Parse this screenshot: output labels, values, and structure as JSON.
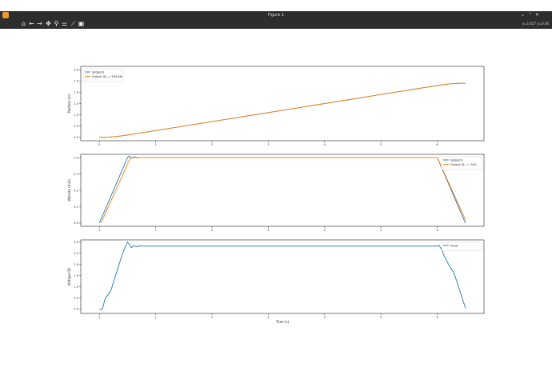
{
  "window": {
    "title": "Figure 1",
    "controls": [
      "⌄",
      "⌃",
      "✕"
    ]
  },
  "toolbar": {
    "tools": [
      {
        "name": "home-icon",
        "glyph": "⌂"
      },
      {
        "name": "back-icon",
        "glyph": "←"
      },
      {
        "name": "forward-icon",
        "glyph": "→"
      },
      {
        "name": "pan-icon",
        "glyph": "✥"
      },
      {
        "name": "zoom-icon",
        "glyph": "⚲"
      },
      {
        "name": "subplots-icon",
        "glyph": "⚌"
      },
      {
        "name": "edit-axes-icon",
        "glyph": "⟋"
      },
      {
        "name": "save-icon",
        "glyph": "▣"
      }
    ],
    "coords": "x=1.627 y=0.46"
  },
  "colors": {
    "setpoint": "#1f77b4",
    "output": "#ff7f0e"
  },
  "chart_data": [
    {
      "type": "line",
      "ylabel": "Position (m)",
      "xlabel": "",
      "xlim": [
        -0.33,
        6.83
      ],
      "ylim": [
        -0.15,
        3.15
      ],
      "xticks": [
        0,
        1,
        2,
        3,
        4,
        5,
        6
      ],
      "yticks": [
        0.0,
        0.5,
        1.0,
        1.5,
        2.0,
        2.5,
        3.0
      ],
      "legend": "top-left",
      "series": [
        {
          "name": "Setpoint",
          "color": "#1f77b4",
          "x": [
            0,
            0.1,
            0.2,
            0.3,
            0.4,
            0.5,
            0.57,
            1,
            2,
            3,
            4,
            5,
            6,
            6.1,
            6.2,
            6.3,
            6.4,
            6.5
          ],
          "y": [
            0,
            0.0041,
            0.0165,
            0.0371,
            0.066,
            0.1031,
            0.1344,
            0.3,
            0.7,
            1.1,
            1.5,
            1.9,
            2.3,
            2.3377,
            2.3656,
            2.3854,
            2.3966,
            2.4
          ]
        },
        {
          "name": "Output ($K_p$ = 334.46)",
          "color": "#ff7f0e",
          "x": [
            0,
            0.1,
            0.2,
            0.3,
            0.4,
            0.5,
            0.57,
            1,
            2,
            3,
            4,
            5,
            6,
            6.1,
            6.2,
            6.3,
            6.4,
            6.5
          ],
          "y": [
            0,
            0.0041,
            0.0165,
            0.0371,
            0.066,
            0.1031,
            0.1344,
            0.3,
            0.7,
            1.1,
            1.5,
            1.9,
            2.3,
            2.3377,
            2.3656,
            2.3854,
            2.3966,
            2.4
          ]
        }
      ]
    },
    {
      "type": "line",
      "ylabel": "Velocity (m/s)",
      "xlabel": "",
      "xlim": [
        -0.33,
        6.83
      ],
      "ylim": [
        -0.02,
        0.42
      ],
      "xticks": [
        0,
        1,
        2,
        3,
        4,
        5,
        6
      ],
      "yticks": [
        0.0,
        0.1,
        0.2,
        0.3,
        0.4
      ],
      "legend": "top-right",
      "series": [
        {
          "name": "Setpoint",
          "color": "#1f77b4",
          "x": [
            0,
            0.5,
            0.53,
            0.57,
            0.62,
            0.66,
            0.7,
            6.0,
            6.5
          ],
          "y": [
            0,
            0.4,
            0.41,
            0.395,
            0.405,
            0.398,
            0.4,
            0.4,
            0
          ]
        },
        {
          "name": "Output ($K_v$ = -3.6)",
          "color": "#ff7f0e",
          "x": [
            0.03,
            0.55,
            6.0,
            6.5
          ],
          "y": [
            0,
            0.4,
            0.4,
            0.02
          ]
        }
      ]
    },
    {
      "type": "line",
      "ylabel": "Voltage (V)",
      "xlabel": "Time (s)",
      "xlim": [
        -0.33,
        6.83
      ],
      "ylim": [
        -0.2,
        3.1
      ],
      "xticks": [
        0,
        1,
        2,
        3,
        4,
        5,
        6
      ],
      "yticks": [
        0.0,
        0.5,
        1.0,
        1.5,
        2.0,
        2.5,
        3.0
      ],
      "legend": "top-right",
      "series": [
        {
          "name": "Input",
          "color": "#1f77b4",
          "x": [
            0,
            0.03,
            0.06,
            0.1,
            0.14,
            0.2,
            0.3,
            0.4,
            0.47,
            0.5,
            0.53,
            0.57,
            0.61,
            0.66,
            0.72,
            0.8,
            6.0,
            6.03,
            6.07,
            6.12,
            6.2,
            6.3,
            6.5
          ],
          "y": [
            -0.02,
            -0.03,
            0.05,
            0.45,
            0.6,
            0.8,
            1.6,
            2.4,
            2.85,
            3.0,
            2.9,
            2.75,
            2.85,
            2.8,
            2.83,
            2.82,
            2.82,
            2.85,
            2.7,
            2.4,
            2.0,
            1.6,
            0.05
          ]
        }
      ]
    }
  ]
}
